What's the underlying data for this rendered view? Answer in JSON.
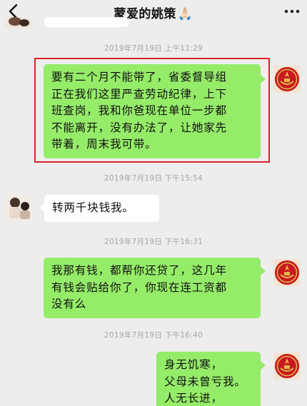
{
  "header": {
    "title": "蒙爱的姚策",
    "title_emoji": "🙏🏻",
    "back_icon": "chevron-left-icon",
    "more_icon": "more-dots-icon"
  },
  "messages": [
    {
      "timestamp": "2019年7月19日 上午11:29",
      "side": "right",
      "lines": [
        "要有二个月不能带了，省委督导组",
        "正在我们这里严查劳动纪律，上下",
        "班查岗，我和你爸现在单位一步都",
        "不能离开，没有办法了，让她家先",
        "带着，周末我可带。"
      ],
      "highlighted": true
    },
    {
      "timestamp": "2019年7月19日 下午15:54",
      "side": "left",
      "lines": [
        "转两千块钱我。"
      ]
    },
    {
      "timestamp": "2019年7月19日 下午16:31",
      "side": "right",
      "lines": [
        "我那有钱，都帮你还贷了，这几年",
        "有钱会贴给你了，你现在连工资都",
        "没有么"
      ]
    },
    {
      "timestamp": "2019年7月19日 下午16:40",
      "side": "right",
      "lines": [
        "身无饥寒，",
        "父母未曾亏我。",
        "人无长进，"
      ]
    }
  ],
  "colors": {
    "background": "#ededed",
    "sent_bubble": "#95ec69",
    "received_bubble": "#ffffff",
    "timestamp_text": "#a4a4a4",
    "highlight_border": "#d9232a",
    "emblem_red": "#c8191f",
    "emblem_gold": "#e0b84a"
  }
}
